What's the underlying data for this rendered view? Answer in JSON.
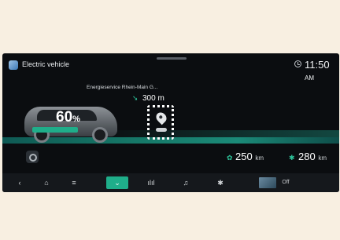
{
  "header": {
    "app_title": "Electric vehicle",
    "clock": "11:50",
    "clock_suffix": "AM"
  },
  "vehicle": {
    "battery_percent_value": "60",
    "battery_percent_sign": "%",
    "battery_level": 0.6
  },
  "poi": {
    "name": "Energieservice Rhein-Main G...",
    "distance": "300 m"
  },
  "range": {
    "eco_value": "250",
    "eco_unit": "km",
    "normal_value": "280",
    "normal_unit": "km"
  },
  "navbar": {
    "back_label": "‹",
    "home_label": "⌂",
    "menu_label": "≡",
    "ev_label": "⌄",
    "stats_label": "ılıl",
    "media_label": "♫",
    "settings_label": "✱",
    "off_label": "Off"
  },
  "colors": {
    "accent": "#1fae8a",
    "background": "#0b0d10"
  }
}
